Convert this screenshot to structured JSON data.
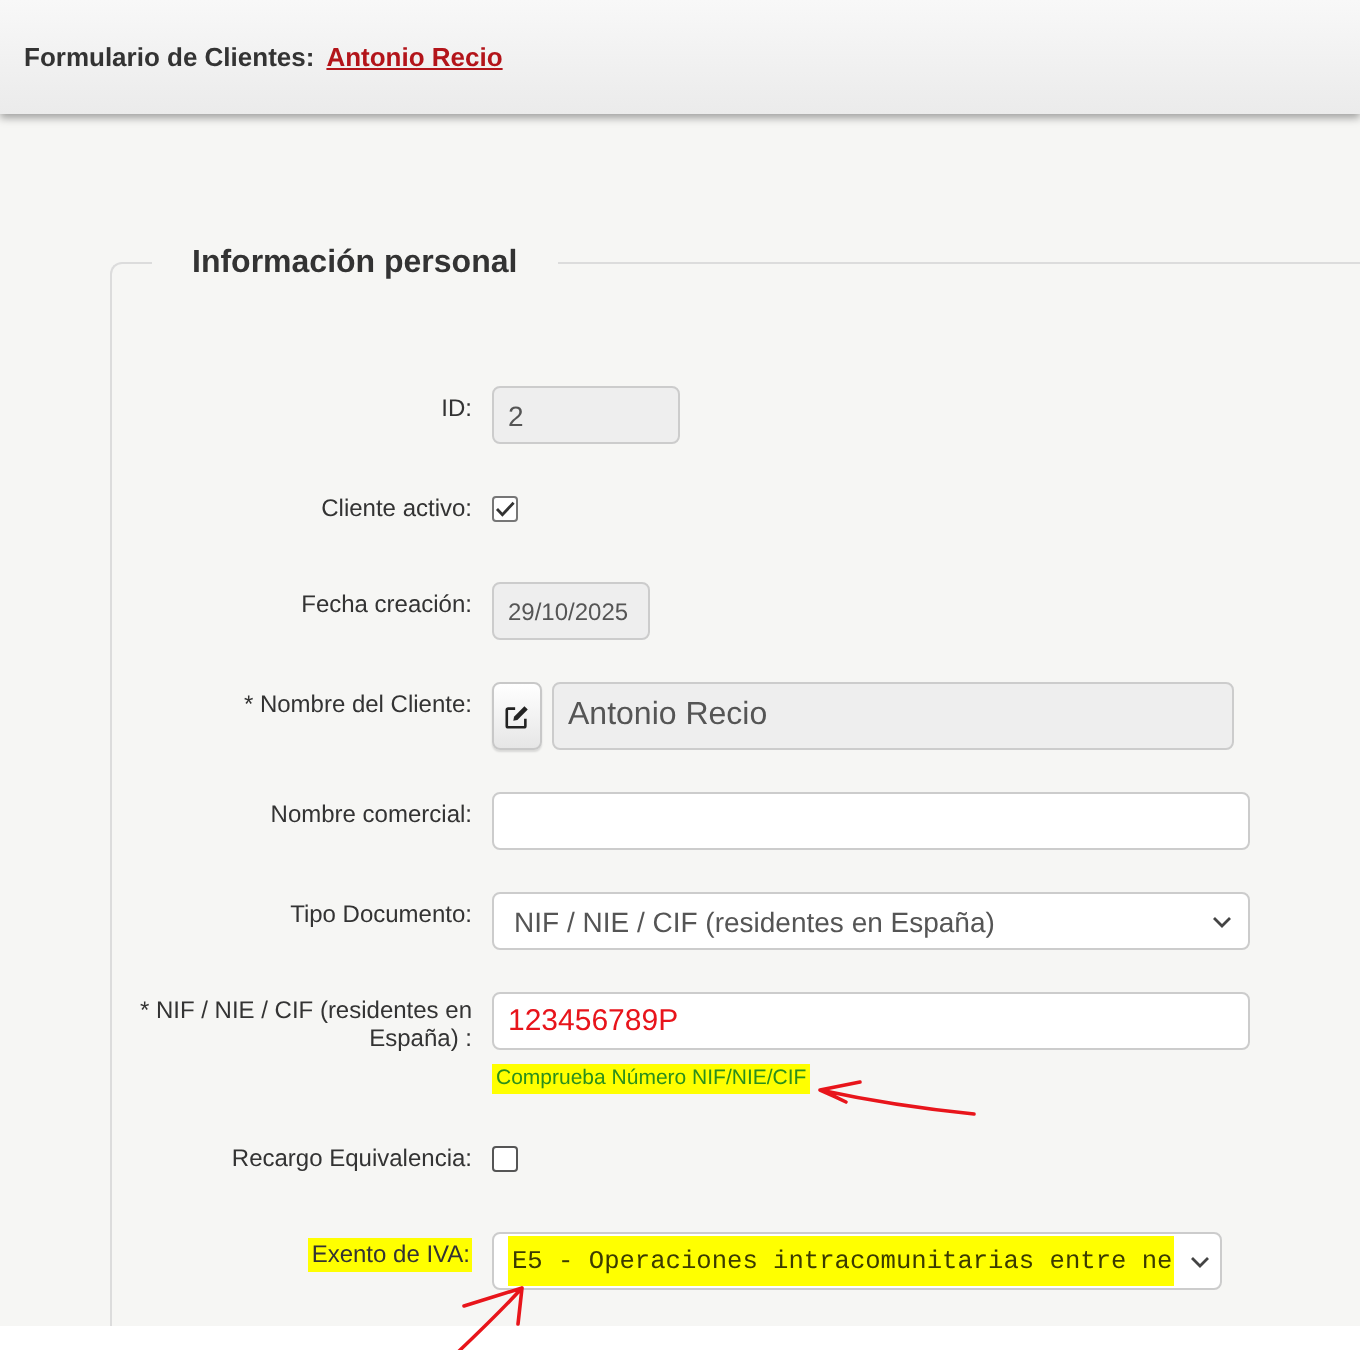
{
  "header": {
    "title": "Formulario de Clientes:",
    "client_link": "Antonio Recio"
  },
  "fieldset": {
    "legend": "Información personal",
    "fields": [
      {
        "kind": "input",
        "label": "ID:",
        "label_highlighted": false,
        "value": "2",
        "disabled": true,
        "invalid": false,
        "value_highlighted": false,
        "arrow": false
      },
      {
        "kind": "checkbox",
        "label": "Cliente activo:",
        "label_highlighted": false,
        "checked": true
      },
      {
        "kind": "input",
        "label": "Fecha creación:",
        "label_highlighted": false,
        "value": "29/10/2025",
        "disabled": true,
        "invalid": false,
        "value_highlighted": false,
        "arrow": false
      },
      {
        "kind": "editinput",
        "label": "* Nombre del Cliente:",
        "label_highlighted": false,
        "value": "Antonio Recio",
        "disabled": true,
        "invalid": false,
        "value_highlighted": false,
        "arrow": false
      },
      {
        "kind": "input",
        "label": "Nombre comercial:",
        "label_highlighted": false,
        "disabled": false
      },
      {
        "kind": "select",
        "label": "Tipo Documento:",
        "label_highlighted": false,
        "value": "NIF / NIE / CIF (residentes en España)",
        "value_highlighted": false,
        "arrow": false
      },
      {
        "kind": "input",
        "label": "* NIF / NIE / CIF (residentes en España) :",
        "label_highlighted": false,
        "value": "123456789P",
        "disabled": false,
        "invalid": true,
        "value_highlighted": false,
        "arrow": false,
        "hint": {
          "text": "Comprueba Número NIF/NIE/CIF",
          "highlighted": true,
          "arrow": true
        }
      },
      {
        "kind": "checkbox",
        "label": "Recargo Equivalencia:",
        "label_highlighted": false,
        "checked": false
      },
      {
        "kind": "codeselect",
        "label": "Exento de IVA:",
        "label_highlighted": true,
        "value": "E5 - Operaciones intracomunitarias entre ne",
        "value_highlighted": true,
        "arrow": true
      }
    ]
  }
}
